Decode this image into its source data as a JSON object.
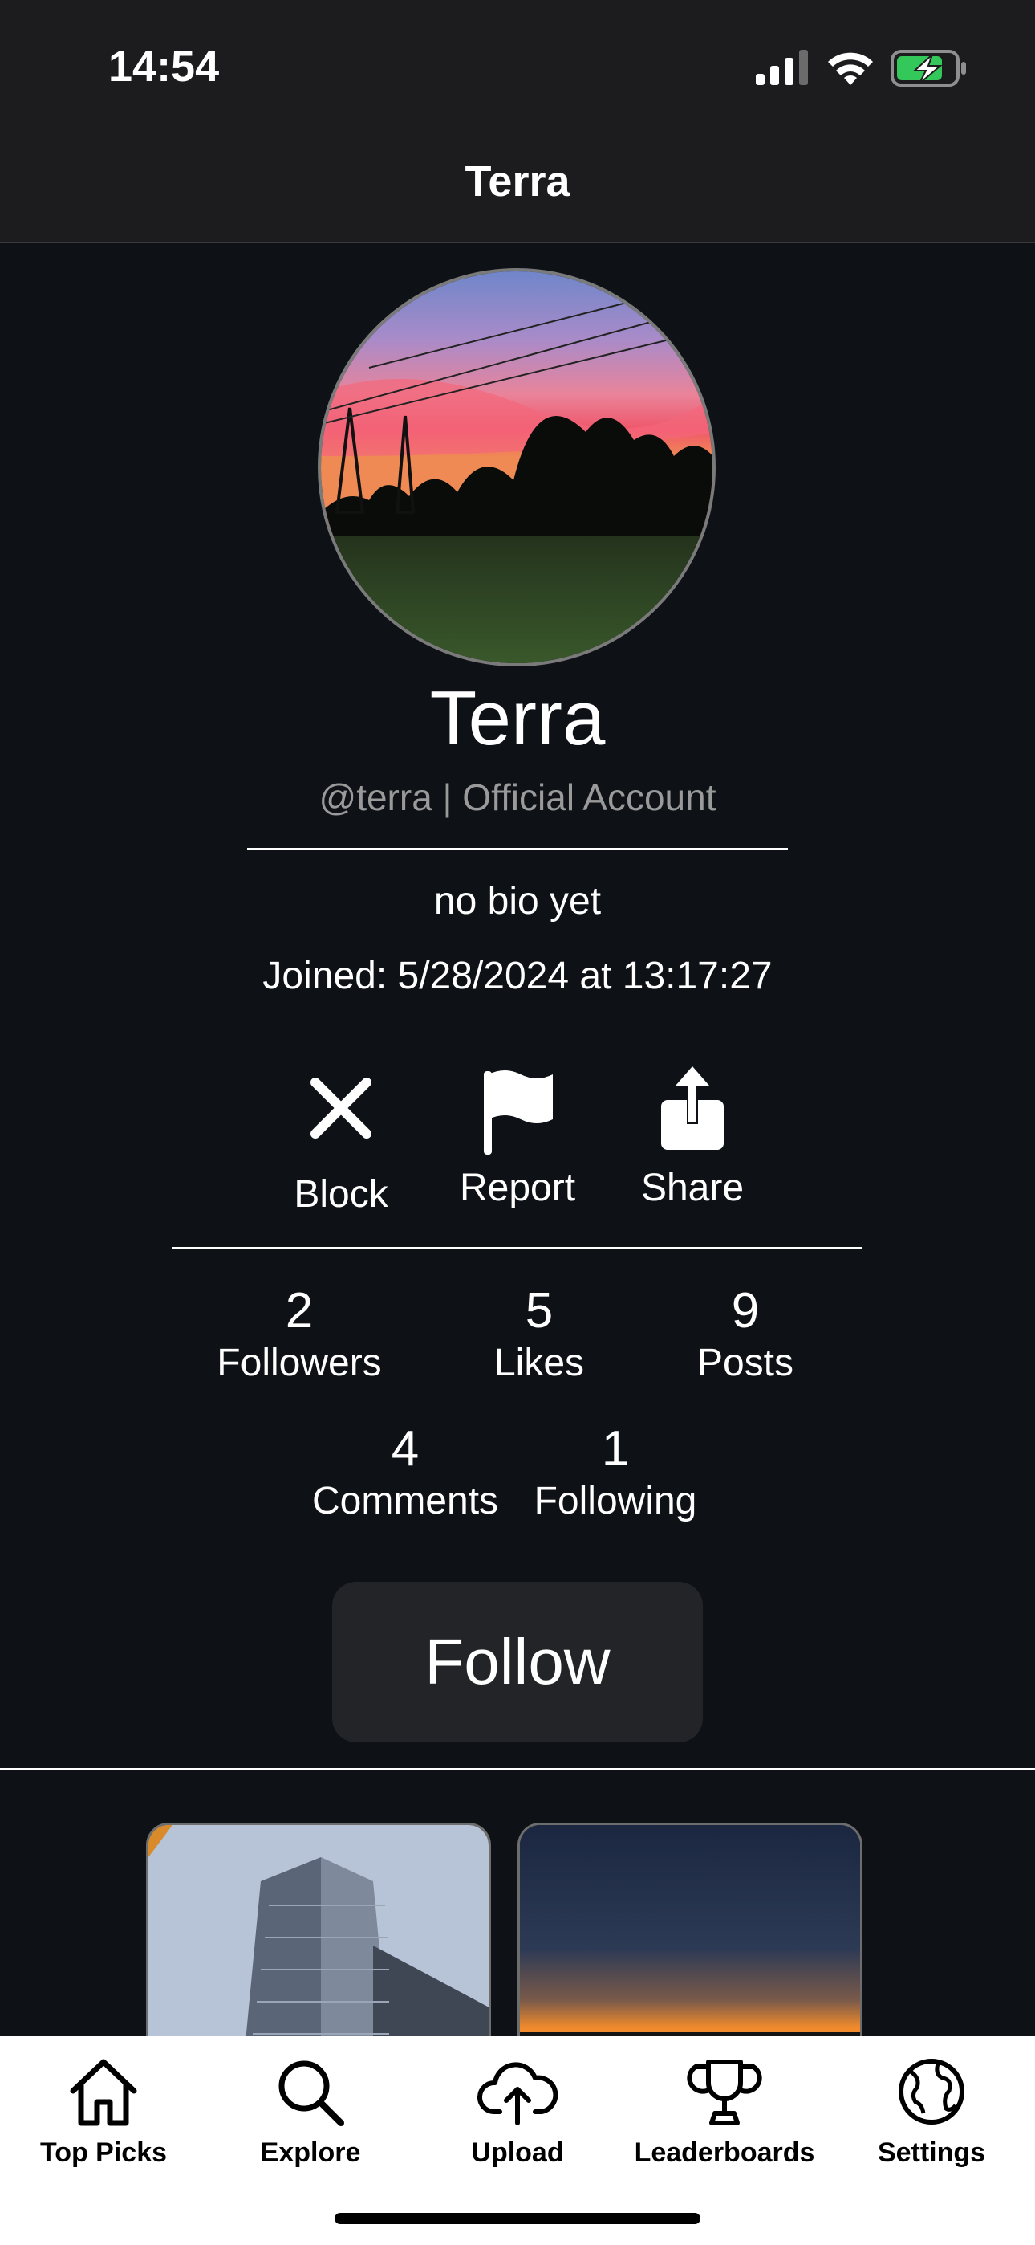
{
  "status_bar": {
    "time": "14:54"
  },
  "nav": {
    "title": "Terra"
  },
  "profile": {
    "display_name": "Terra",
    "handle": "@terra | Official Account",
    "bio": "no bio yet",
    "joined": "Joined: 5/28/2024 at 13:17:27"
  },
  "actions": {
    "block": "Block",
    "report": "Report",
    "share": "Share"
  },
  "stats": {
    "followers": {
      "value": "2",
      "label": "Followers"
    },
    "likes": {
      "value": "5",
      "label": "Likes"
    },
    "posts": {
      "value": "9",
      "label": "Posts"
    },
    "comments": {
      "value": "4",
      "label": "Comments"
    },
    "following": {
      "value": "1",
      "label": "Following"
    }
  },
  "follow_button": {
    "label": "Follow"
  },
  "tabs": [
    {
      "label": "Top Picks",
      "icon": "house-icon"
    },
    {
      "label": "Explore",
      "icon": "search-icon"
    },
    {
      "label": "Upload",
      "icon": "cloud-upload-icon"
    },
    {
      "label": "Leaderboards",
      "icon": "trophy-icon"
    },
    {
      "label": "Settings",
      "icon": "globe-icon"
    }
  ],
  "colors": {
    "background": "#0e1116",
    "topbar": "#1c1c1e",
    "button": "#232427",
    "battery": "#34c759"
  }
}
